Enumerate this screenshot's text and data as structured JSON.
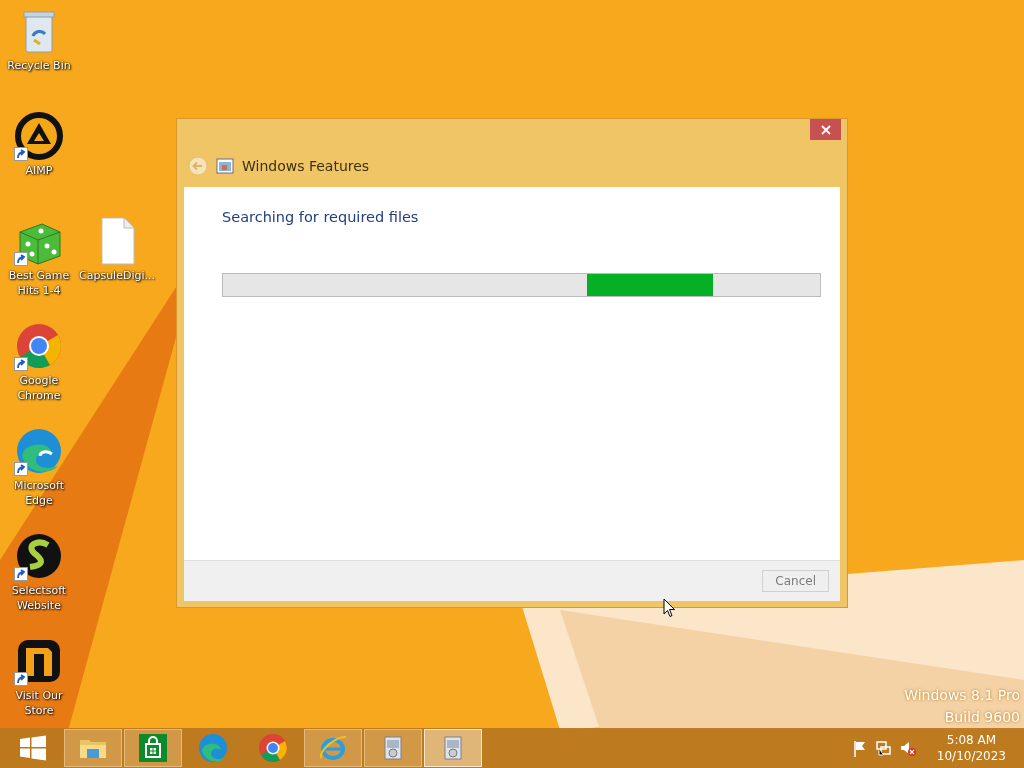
{
  "desktop": {
    "columns": [
      {
        "icons": [
          {
            "label": "Recycle Bin",
            "kind": "recycle",
            "shortcut": false
          },
          {
            "label": "AIMP",
            "kind": "aimp",
            "shortcut": true
          },
          {
            "label": "Best Game Hits 1-4",
            "kind": "dice",
            "shortcut": true
          },
          {
            "label": "Google Chrome",
            "kind": "chrome",
            "shortcut": true
          },
          {
            "label": "Microsoft Edge",
            "kind": "edge",
            "shortcut": true
          },
          {
            "label": "Selectsoft Website",
            "kind": "selectsoft",
            "shortcut": true
          },
          {
            "label": "Visit Our Store",
            "kind": "store",
            "shortcut": true
          }
        ]
      },
      {
        "icons": [
          {
            "label": "CapsuleDigi...",
            "kind": "file",
            "shortcut": false
          }
        ]
      }
    ],
    "os_edition": "Windows 8.1 Pro",
    "os_build": "Build 9600"
  },
  "window": {
    "title": "Windows Features",
    "heading": "Searching for required files",
    "progress": {
      "indeterminate": true
    },
    "buttons": [
      {
        "label": "Cancel",
        "disabled": true
      }
    ]
  },
  "taskbar": {
    "items": [
      {
        "kind": "explorer",
        "running": true,
        "selected": false
      },
      {
        "kind": "store",
        "running": true,
        "selected": false
      },
      {
        "kind": "edge",
        "running": false,
        "selected": false
      },
      {
        "kind": "chrome",
        "running": false,
        "selected": false
      },
      {
        "kind": "ie",
        "running": true,
        "selected": false
      },
      {
        "kind": "features",
        "running": true,
        "selected": false
      },
      {
        "kind": "features",
        "running": true,
        "selected": true
      }
    ],
    "tray": [
      {
        "kind": "flag"
      },
      {
        "kind": "network"
      },
      {
        "kind": "muted"
      }
    ],
    "time": "5:08 AM",
    "date": "10/10/2023"
  }
}
